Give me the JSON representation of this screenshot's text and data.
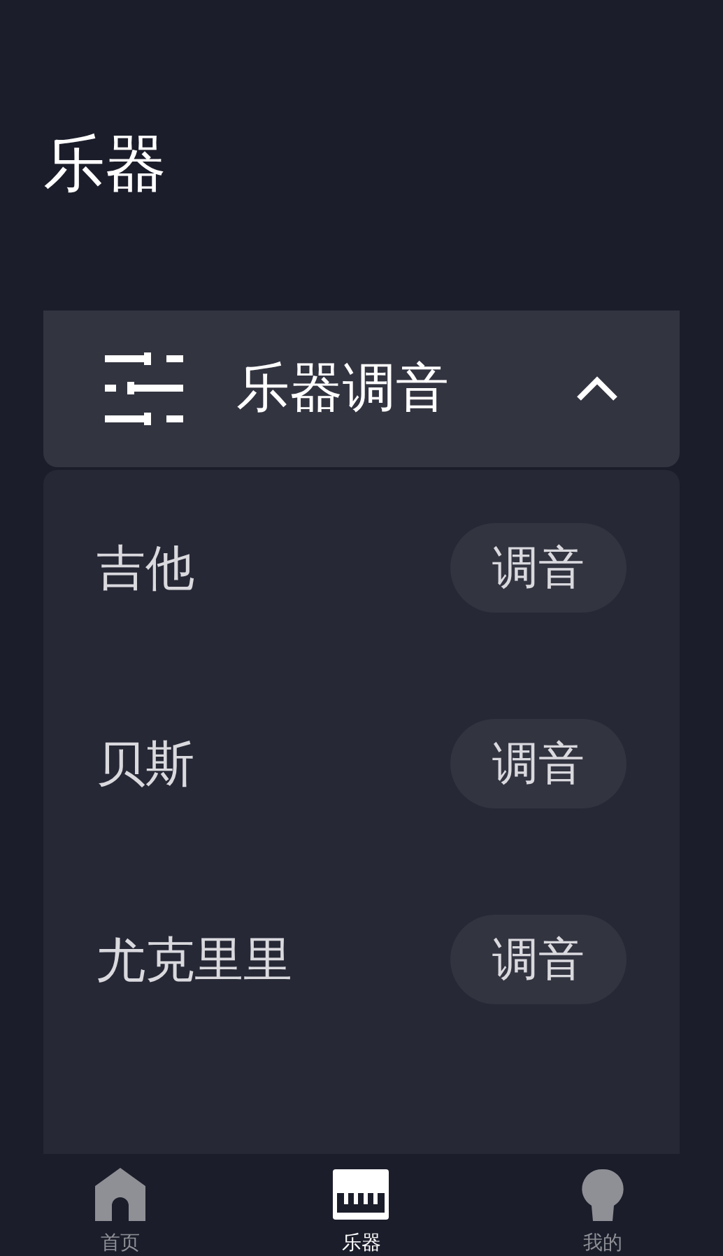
{
  "page_title": "乐器",
  "section": {
    "title": "乐器调音",
    "expanded": true
  },
  "instruments": [
    {
      "name": "吉他",
      "action": "调音"
    },
    {
      "name": "贝斯",
      "action": "调音"
    },
    {
      "name": "尤克里里",
      "action": "调音"
    }
  ],
  "tab_bar": [
    {
      "label": "首页",
      "kind": "home",
      "selected": false
    },
    {
      "label": "乐器",
      "kind": "piano",
      "selected": true
    },
    {
      "label": "我的",
      "kind": "profile",
      "selected": false
    }
  ]
}
